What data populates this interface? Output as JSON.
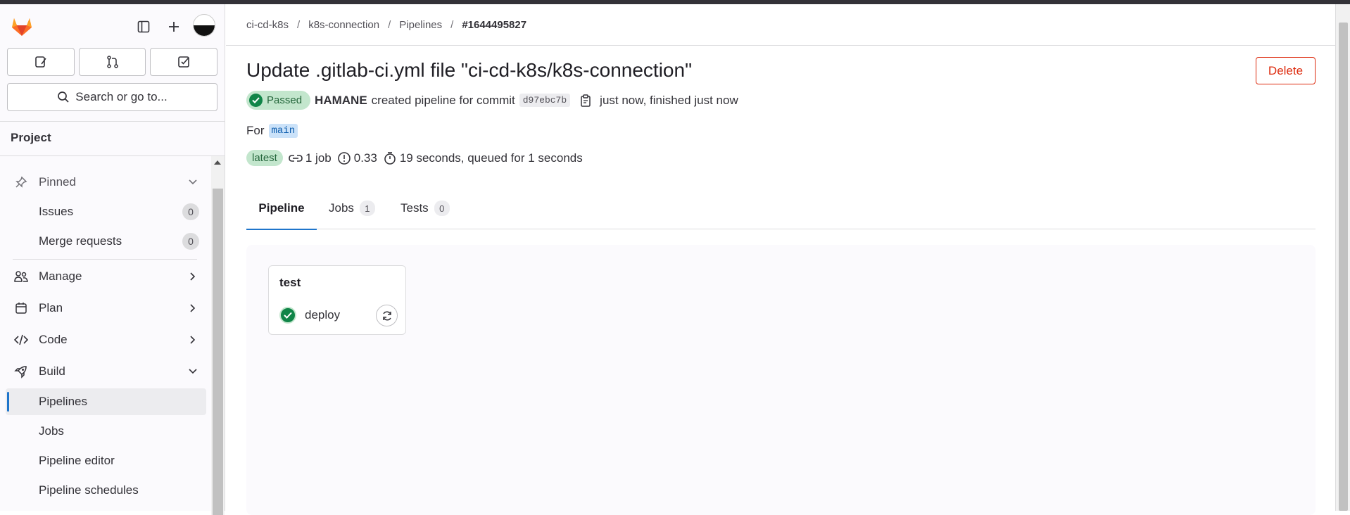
{
  "sidebar": {
    "search_label": "Search or go to...",
    "project_heading": "Project",
    "pinned_label": "Pinned",
    "items": [
      {
        "label": "Issues",
        "count": "0"
      },
      {
        "label": "Merge requests",
        "count": "0"
      },
      {
        "label": "Manage"
      },
      {
        "label": "Plan"
      },
      {
        "label": "Code"
      },
      {
        "label": "Build"
      },
      {
        "label": "Pipelines"
      },
      {
        "label": "Jobs"
      },
      {
        "label": "Pipeline editor"
      },
      {
        "label": "Pipeline schedules"
      }
    ]
  },
  "breadcrumb": [
    "ci-cd-k8s",
    "k8s-connection",
    "Pipelines",
    "#1644495827"
  ],
  "page": {
    "title": "Update .gitlab-ci.yml file \"ci-cd-k8s/k8s-connection\"",
    "delete_label": "Delete",
    "status": "Passed",
    "author": "HAMANE",
    "created_text": "created pipeline for commit",
    "commit_sha": "d97ebc7b",
    "time_text": "just now, finished just now",
    "for_label": "For",
    "ref": "main",
    "latest_badge": "latest",
    "jobs_count_text": "1 job",
    "score": "0.33",
    "duration_text": "19 seconds, queued for 1 seconds"
  },
  "tabs": [
    {
      "label": "Pipeline"
    },
    {
      "label": "Jobs",
      "count": "1"
    },
    {
      "label": "Tests",
      "count": "0"
    }
  ],
  "graph": {
    "stage_name": "test",
    "job_name": "deploy"
  },
  "colors": {
    "accent": "#1f75cb",
    "success": "#108548",
    "danger": "#dd2b0e"
  }
}
